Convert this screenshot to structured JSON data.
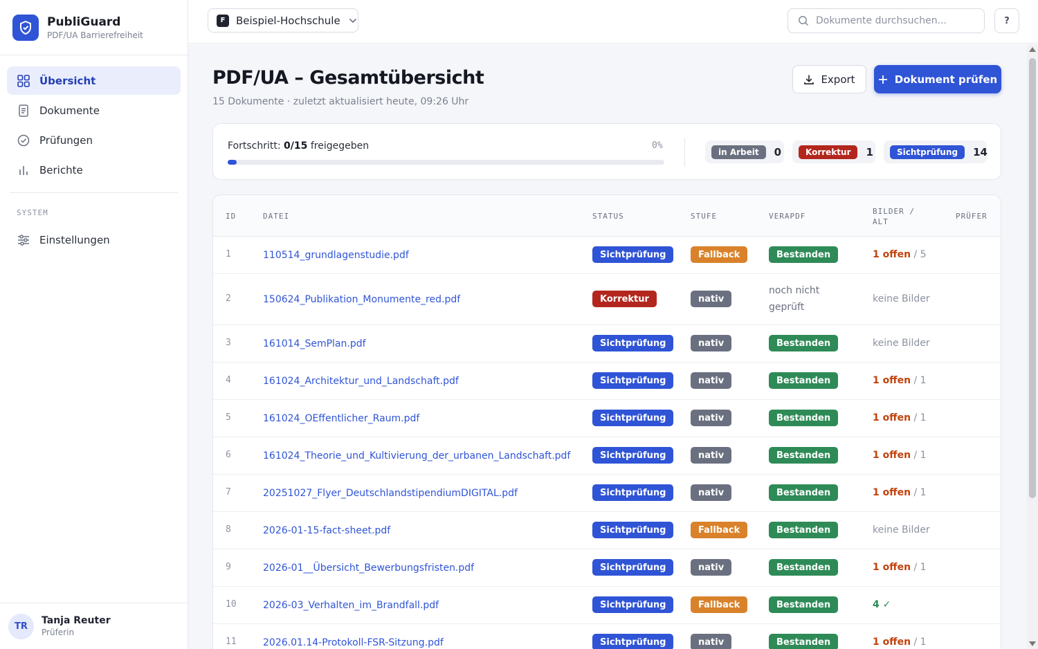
{
  "brand": {
    "title": "PubliGuard",
    "subtitle": "PDF/UA Barrierefreiheit"
  },
  "nav": {
    "items": [
      {
        "label": "Übersicht",
        "icon": "grid-icon",
        "active": true
      },
      {
        "label": "Dokumente",
        "icon": "document-icon",
        "active": false
      },
      {
        "label": "Prüfungen",
        "icon": "check-circle-icon",
        "active": false
      },
      {
        "label": "Berichte",
        "icon": "bar-chart-icon",
        "active": false
      }
    ],
    "section_label": "SYSTEM",
    "settings": {
      "label": "Einstellungen",
      "icon": "sliders-icon"
    }
  },
  "user": {
    "initials": "TR",
    "name": "Tanja Reuter",
    "role": "Prüferin"
  },
  "topbar": {
    "org_badge": "F",
    "org_name": "Beispiel-Hochschule",
    "search_placeholder": "Dokumente durchsuchen...",
    "help_label": "?"
  },
  "page": {
    "title": "PDF/UA – Gesamtübersicht",
    "subtitle": "15 Dokumente · zuletzt aktualisiert heute, 09:26 Uhr",
    "export_label": "Export",
    "primary_label": "Dokument prüfen"
  },
  "progress": {
    "label_prefix": "Fortschritt:",
    "value_text": "0/15",
    "label_suffix": "freigegeben",
    "percent_text": "0%",
    "fraction": 0,
    "chips": [
      {
        "label": "in Arbeit",
        "count": "0",
        "tone": "arbeit"
      },
      {
        "label": "Korrektur",
        "count": "1",
        "tone": "korr"
      },
      {
        "label": "Sichtprüfung",
        "count": "14",
        "tone": "sicht"
      }
    ]
  },
  "colors": {
    "accent": "#2f54d6",
    "korrektur": "#b3261e",
    "fallback": "#d9822b",
    "nativ": "#6b7080",
    "bestanden": "#2e8b57",
    "offen": "#c2410c"
  },
  "table": {
    "headers": {
      "id": "ID",
      "file": "DATEI",
      "status": "STATUS",
      "stufe": "STUFE",
      "verapdf": "VERAPDF",
      "bilder1": "BILDER /",
      "bilder2": "ALT",
      "pruefer": "PRÜFER"
    },
    "rows": [
      {
        "id": "1",
        "file": "110514_grundlagenstudie.pdf",
        "status": "Sichtprüfung",
        "stufe": "Fallback",
        "vera": "Bestanden",
        "bild": {
          "type": "open",
          "open": "1 offen",
          "total": "/ 5"
        }
      },
      {
        "id": "2",
        "file": "150624_Publikation_Monumente_red.pdf",
        "status": "Korrektur",
        "stufe": "nativ",
        "vera": "noch nicht geprüft",
        "bild": {
          "type": "none",
          "text": "keine Bilder"
        }
      },
      {
        "id": "3",
        "file": "161014_SemPlan.pdf",
        "status": "Sichtprüfung",
        "stufe": "nativ",
        "vera": "Bestanden",
        "bild": {
          "type": "none",
          "text": "keine Bilder"
        }
      },
      {
        "id": "4",
        "file": "161024_Architektur_und_Landschaft.pdf",
        "status": "Sichtprüfung",
        "stufe": "nativ",
        "vera": "Bestanden",
        "bild": {
          "type": "open",
          "open": "1 offen",
          "total": "/ 1"
        }
      },
      {
        "id": "5",
        "file": "161024_OEffentlicher_Raum.pdf",
        "status": "Sichtprüfung",
        "stufe": "nativ",
        "vera": "Bestanden",
        "bild": {
          "type": "open",
          "open": "1 offen",
          "total": "/ 1"
        }
      },
      {
        "id": "6",
        "file": "161024_Theorie_und_Kultivierung_der_urbanen_Landschaft.pdf",
        "status": "Sichtprüfung",
        "stufe": "nativ",
        "vera": "Bestanden",
        "bild": {
          "type": "open",
          "open": "1 offen",
          "total": "/ 1"
        }
      },
      {
        "id": "7",
        "file": "20251027_Flyer_DeutschlandstipendiumDIGITAL.pdf",
        "status": "Sichtprüfung",
        "stufe": "nativ",
        "vera": "Bestanden",
        "bild": {
          "type": "open",
          "open": "1 offen",
          "total": "/ 1"
        }
      },
      {
        "id": "8",
        "file": "2026-01-15-fact-sheet.pdf",
        "status": "Sichtprüfung",
        "stufe": "Fallback",
        "vera": "Bestanden",
        "bild": {
          "type": "none",
          "text": "keine Bilder"
        }
      },
      {
        "id": "9",
        "file": "2026-01__Übersicht_Bewerbungsfristen.pdf",
        "status": "Sichtprüfung",
        "stufe": "nativ",
        "vera": "Bestanden",
        "bild": {
          "type": "open",
          "open": "1 offen",
          "total": "/ 1"
        }
      },
      {
        "id": "10",
        "file": "2026-03_Verhalten_im_Brandfall.pdf",
        "status": "Sichtprüfung",
        "stufe": "Fallback",
        "vera": "Bestanden",
        "bild": {
          "type": "done",
          "text": "4 ✓"
        }
      },
      {
        "id": "11",
        "file": "2026.01.14-Protokoll-FSR-Sitzung.pdf",
        "status": "Sichtprüfung",
        "stufe": "nativ",
        "vera": "Bestanden",
        "bild": {
          "type": "open",
          "open": "1 offen",
          "total": "/ 1"
        }
      }
    ]
  }
}
